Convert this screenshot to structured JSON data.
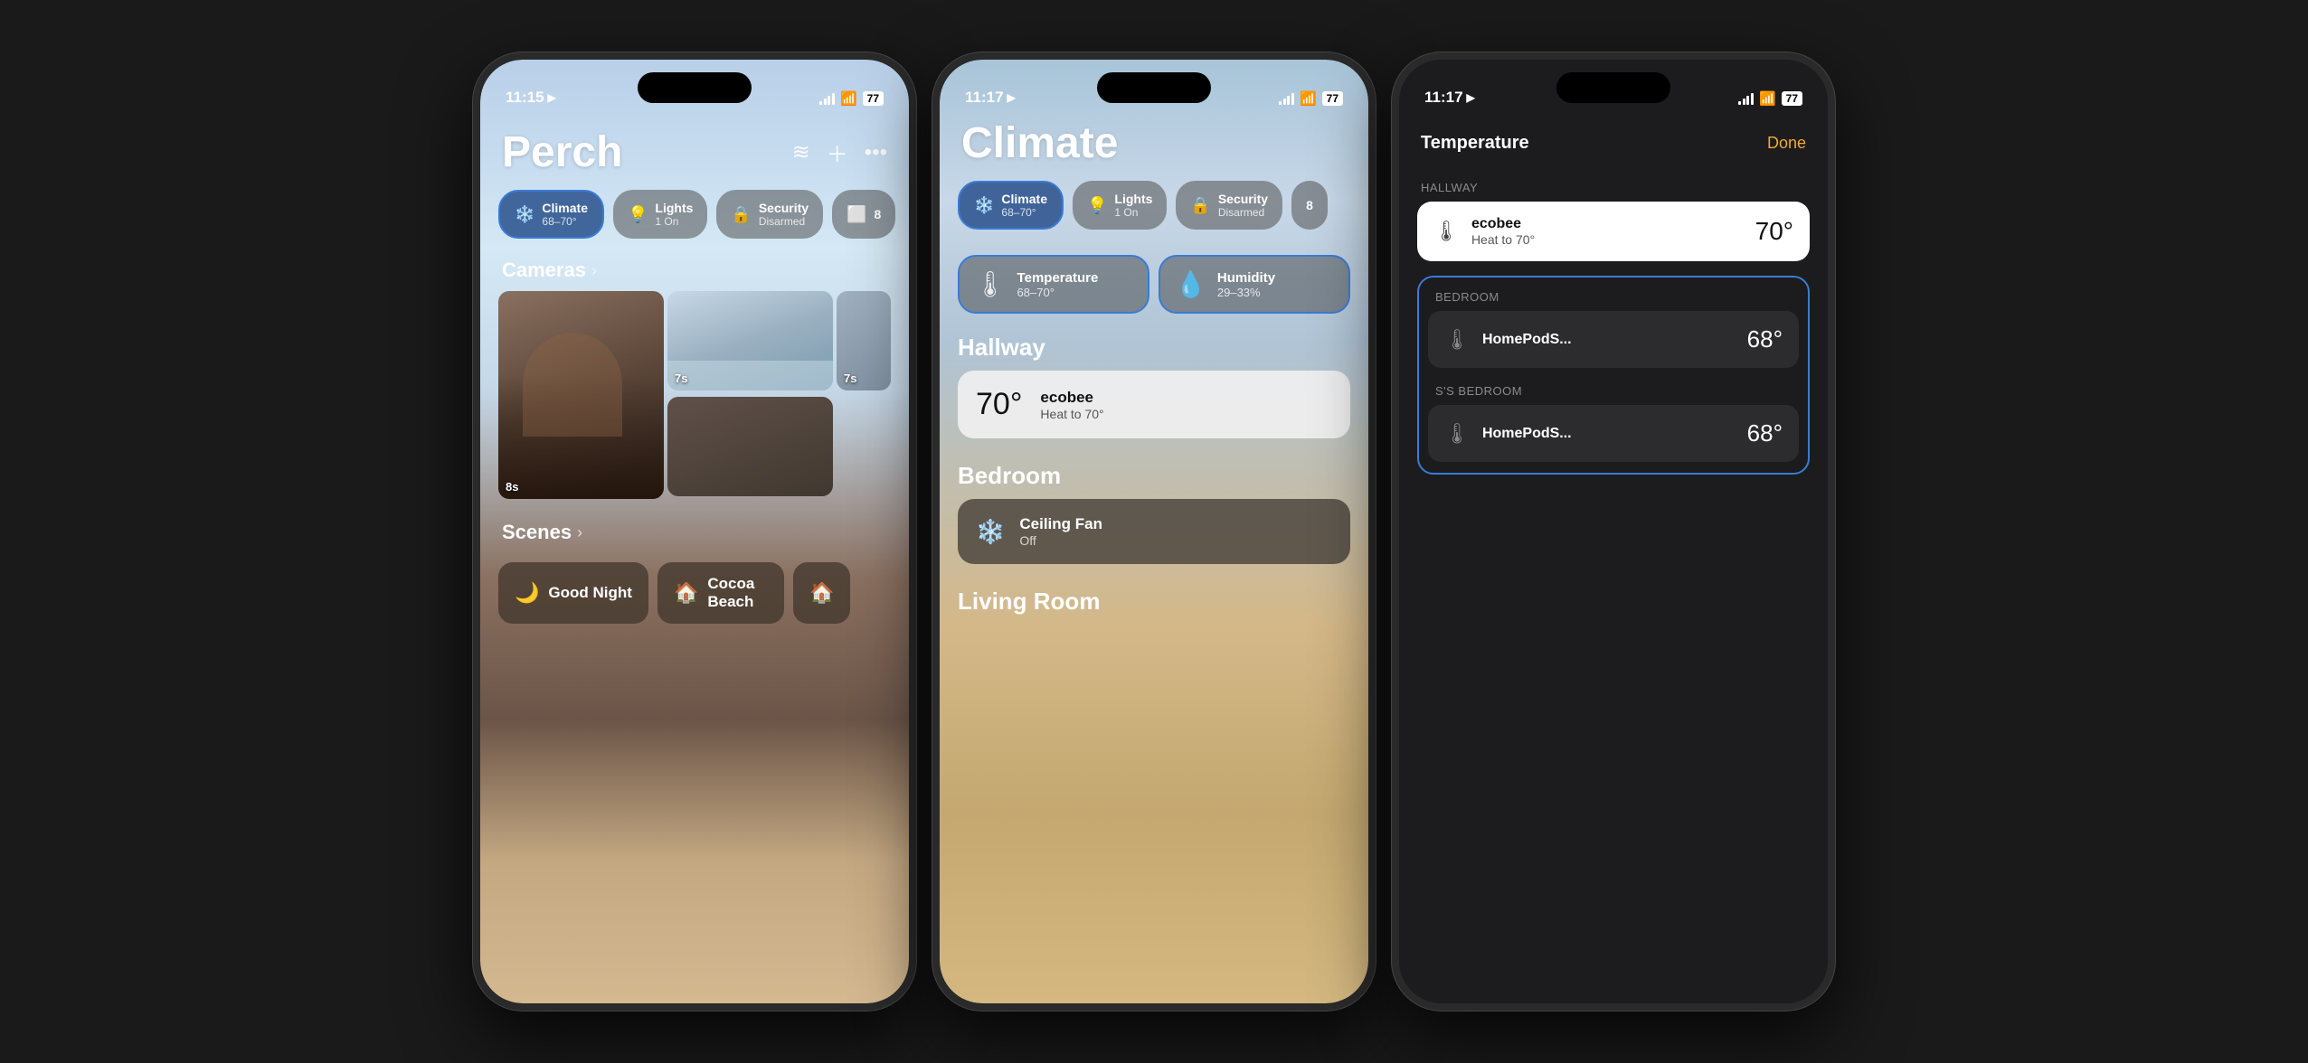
{
  "phone1": {
    "statusBar": {
      "time": "11:15",
      "locationArrow": "▶",
      "battery": "77"
    },
    "headerIcons": {
      "waveform": "≋",
      "plus": "+",
      "ellipsis": "···"
    },
    "title": "Perch",
    "pills": [
      {
        "id": "climate",
        "icon": "❄️",
        "label": "Climate",
        "sub": "68–70°",
        "active": true
      },
      {
        "id": "lights",
        "icon": "💡",
        "label": "Lights",
        "sub": "1 On",
        "active": false
      },
      {
        "id": "security",
        "icon": "🔒",
        "label": "Security",
        "sub": "Disarmed",
        "active": false
      }
    ],
    "cameras": {
      "label": "Cameras",
      "cells": [
        {
          "id": "cam1",
          "timer": "8s"
        },
        {
          "id": "cam2",
          "timer": "7s"
        },
        {
          "id": "cam3",
          "timer": "7s"
        },
        {
          "id": "cam4",
          "timer": ""
        }
      ]
    },
    "scenes": {
      "label": "Scenes",
      "items": [
        {
          "id": "good-night",
          "icon": "🌙",
          "label": "Good Night"
        },
        {
          "id": "cocoa-beach",
          "icon": "🏠",
          "label": "Cocoa Beach"
        },
        {
          "id": "scene3",
          "icon": "🏠",
          "label": ""
        }
      ]
    }
  },
  "phone2": {
    "statusBar": {
      "time": "11:17",
      "battery": "77"
    },
    "title": "Climate",
    "pills": [
      {
        "id": "climate",
        "icon": "❄️",
        "label": "Climate",
        "sub": "68–70°",
        "active": true
      },
      {
        "id": "lights",
        "icon": "💡",
        "label": "Lights",
        "sub": "1 On",
        "active": false
      },
      {
        "id": "security",
        "icon": "🔒",
        "label": "Security",
        "sub": "Disarmed",
        "active": false
      }
    ],
    "metrics": [
      {
        "id": "temperature",
        "icon": "🌡",
        "label": "Temperature",
        "value": "68–70°"
      },
      {
        "id": "humidity",
        "icon": "💧",
        "label": "Humidity",
        "value": "29–33%"
      }
    ],
    "rooms": [
      {
        "name": "Hallway",
        "devices": [
          {
            "id": "ecobee",
            "temp": "70°",
            "name": "ecobee",
            "status": "Heat to 70°",
            "dark": false
          }
        ]
      },
      {
        "name": "Bedroom",
        "devices": [
          {
            "id": "ceiling-fan",
            "icon": "❄️",
            "name": "Ceiling Fan",
            "status": "Off",
            "dark": true
          }
        ]
      },
      {
        "name": "Living Room",
        "devices": []
      }
    ]
  },
  "phone3": {
    "statusBar": {
      "time": "11:17",
      "battery": "77"
    },
    "title": "Temperature",
    "doneLabel": "Done",
    "groups": [
      {
        "name": "HALLWAY",
        "highlighted": true,
        "devices": [
          {
            "id": "hallway-ecobee",
            "temp": "70°",
            "name": "ecobee",
            "sub": "Heat to 70°",
            "highlighted": true
          }
        ]
      },
      {
        "name": "BEDROOM",
        "highlighted": false,
        "boxed": true,
        "devices": [
          {
            "id": "bedroom-homepod",
            "temp": "68°",
            "name": "HomePodS...",
            "sub": "",
            "highlighted": false
          }
        ]
      },
      {
        "name": "S'S BEDROOM",
        "highlighted": false,
        "boxed": true,
        "devices": [
          {
            "id": "ss-bedroom-homepod",
            "temp": "68°",
            "name": "HomePodS...",
            "sub": "",
            "highlighted": false
          }
        ]
      }
    ]
  }
}
